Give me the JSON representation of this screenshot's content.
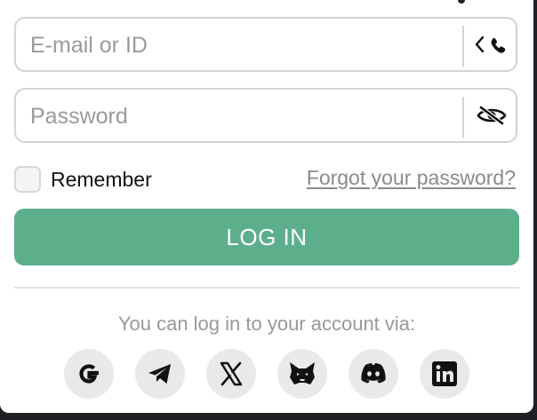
{
  "login": {
    "email": {
      "value": "",
      "placeholder": "E-mail or ID",
      "addon_icon": "chevron-phone-icon"
    },
    "password": {
      "value": "",
      "placeholder": "Password",
      "addon_icon": "eye-slash-icon"
    },
    "remember_label": "Remember",
    "forgot_link": "Forgot your password?",
    "login_button": "LOG IN",
    "via_text": "You can log in to your account via:",
    "social": [
      "google-icon",
      "telegram-icon",
      "x-icon",
      "metamask-icon",
      "discord-icon",
      "linkedin-icon"
    ]
  },
  "colors": {
    "accent": "#5daf8b",
    "border": "#d2d4d4",
    "muted_text": "#999999",
    "social_bg": "#e9e9e9"
  }
}
